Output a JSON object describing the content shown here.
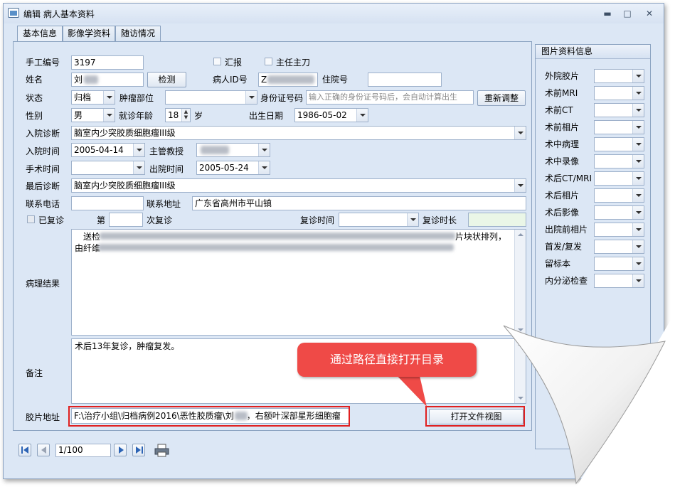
{
  "window": {
    "title": "编辑 病人基本资料",
    "min": "▬",
    "max": "□",
    "close": "✕"
  },
  "tabs": [
    {
      "label": "基本信息"
    },
    {
      "label": "影像学资料"
    },
    {
      "label": "随访情况"
    }
  ],
  "form": {
    "handno_label": "手工编号",
    "handno": "3197",
    "report_label": "汇报",
    "chief_label": "主任主刀",
    "name_label": "姓名",
    "name": "刘",
    "detect_btn": "检测",
    "pid_label": "病人ID号",
    "pid": "Z",
    "inpatient_label": "住院号",
    "inpatient": "",
    "status_label": "状态",
    "status": "归档",
    "site_label": "肿瘤部位",
    "site": "",
    "idcard_label": "身份证号码",
    "idcard_placeholder": "输入正确的身份证号码后，会自动计算出生",
    "readjust_btn": "重新调整",
    "gender_label": "性别",
    "gender": "男",
    "age_label": "就诊年龄",
    "age": "18",
    "age_unit": "岁",
    "birth_label": "出生日期",
    "birth": "1986-05-02",
    "admit_diag_label": "入院诊断",
    "admit_diag": "脑室内少突胶质细胞瘤III级",
    "admit_time_label": "入院时间",
    "admit_time": "2005-04-14",
    "prof_label": "主管教授",
    "prof": "",
    "surg_time_label": "手术时间",
    "surg_time": "",
    "discharge_label": "出院时间",
    "discharge": "2005-05-24",
    "final_diag_label": "最后诊断",
    "final_diag": "脑室内少突胶质细胞瘤III级",
    "phone_label": "联系电话",
    "phone": "",
    "addr_label": "联系地址",
    "addr": "广东省高州市平山镇",
    "revisit_label": "已复诊",
    "nth_label": "第",
    "nth": "",
    "nth_unit": "次复诊",
    "revisit_time_label": "复诊时间",
    "revisit_time": "",
    "revisit_len_label": "复诊时长",
    "revisit_len": "",
    "path_label": "病理结果",
    "path_line1": "送检",
    "path_line2": "由纤维",
    "path_tail": "片块状排列，",
    "note_label": "备注",
    "note": "术后13年复诊，肿瘤复发。",
    "film_label": "胶片地址",
    "film_path_a": "F:\\治疗小组\\归档病例2016\\恶性胶质瘤\\刘",
    "film_path_b": "，右额叶深部星形细胞瘤",
    "open_btn": "打开文件视图"
  },
  "callout": "通过路径直接打开目录",
  "side": {
    "title": "图片资料信息",
    "items": [
      {
        "label": "外院胶片"
      },
      {
        "label": "术前MRI"
      },
      {
        "label": "术前CT"
      },
      {
        "label": "术前相片"
      },
      {
        "label": "术中病理"
      },
      {
        "label": "术中录像"
      },
      {
        "label": "术后CT/MRI"
      },
      {
        "label": "术后相片"
      },
      {
        "label": "术后影像"
      },
      {
        "label": "出院前相片"
      },
      {
        "label": "首发/复发"
      },
      {
        "label": "留标本"
      },
      {
        "label": "内分泌检查"
      }
    ]
  },
  "nav": {
    "record": "1/100"
  }
}
